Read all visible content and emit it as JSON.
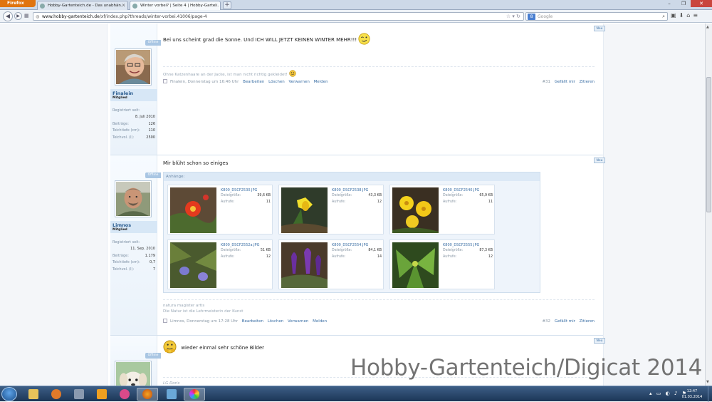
{
  "browser": {
    "menu_label": "Firefox",
    "tabs": [
      {
        "label": "Hobby-Gartenteich.de - Das unabhän..."
      },
      {
        "label": "Winter vorbei? | Seite 4 | Hobby-Garte..."
      }
    ],
    "new_tab": "+",
    "url_domain": "www.hobby-gartenteich.de",
    "url_path": "/xf/index.php?threads/winter-vorbei.41006/page-4",
    "search_placeholder": "Google",
    "search_engine": "8"
  },
  "posts": [
    {
      "status": "Offline",
      "username": "Finalein",
      "role": "Mitglied",
      "registered_label": "Registriert seit:",
      "registered_value": "8. Juli 2010",
      "stats": [
        {
          "label": "Beiträge:",
          "value": "126"
        },
        {
          "label": "Teichtiefe (cm):",
          "value": "110"
        },
        {
          "label": "Teichvol. (l):",
          "value": "2500"
        }
      ],
      "message": "Bei uns scheint grad die Sonne. Und ICH WILL JETZT KEINEN WINTER MEHR!!!",
      "signature": [
        "Ohne Katzenhaare an der Jacke, ist man nicht richtig gekleidet!"
      ],
      "meta": "Finalein, Donnerstag um 16:46 Uhr",
      "actions": [
        "Bearbeiten",
        "Löschen",
        "Verwarnen",
        "Melden"
      ],
      "number": "#31",
      "like": "Gefällt mir",
      "quote": "Zitieren",
      "new_badge": "Neu"
    },
    {
      "status": "Offline",
      "username": "Limnos",
      "role": "Mitglied",
      "registered_label": "Registriert seit:",
      "registered_value": "11. Sep. 2010",
      "stats": [
        {
          "label": "Beiträge:",
          "value": "1.179"
        },
        {
          "label": "Teichtiefe (cm):",
          "value": "0,7"
        },
        {
          "label": "Teichvol. (l):",
          "value": "7"
        }
      ],
      "message": "Mir blüht schon so einiges",
      "attachments_label": "Anhänge:",
      "attachments": [
        {
          "file": "K800_DSCF2530.JPG",
          "size_label": "Dateigröße:",
          "size": "39,6 KB",
          "views_label": "Aufrufe:",
          "views": "11"
        },
        {
          "file": "K800_DSCF2538.JPG",
          "size_label": "Dateigröße:",
          "size": "43,3 KB",
          "views_label": "Aufrufe:",
          "views": "12"
        },
        {
          "file": "K800_DSCF2540.JPG",
          "size_label": "Dateigröße:",
          "size": "65,9 KB",
          "views_label": "Aufrufe:",
          "views": "11"
        },
        {
          "file": "K800_DSCF2552a.JPG",
          "size_label": "Dateigröße:",
          "size": "51 KB",
          "views_label": "Aufrufe:",
          "views": "12"
        },
        {
          "file": "K800_DSCF2554.JPG",
          "size_label": "Dateigröße:",
          "size": "84,1 KB",
          "views_label": "Aufrufe:",
          "views": "14"
        },
        {
          "file": "K800_DSCF2555.JPG",
          "size_label": "Dateigröße:",
          "size": "87,3 KB",
          "views_label": "Aufrufe:",
          "views": "12"
        }
      ],
      "signature": [
        "natura magister artis",
        "Die Natur ist die Lehrmeisterin der Kunst"
      ],
      "meta": "Limnos, Donnerstag um 17:28 Uhr",
      "actions": [
        "Bearbeiten",
        "Löschen",
        "Verwarnen",
        "Melden"
      ],
      "number": "#32",
      "like": "Gefällt mir",
      "quote": "Zitieren",
      "new_badge": "Neu"
    },
    {
      "status": "Offline",
      "message": "wieder einmal sehr schöne Bilder",
      "signature": [
        "LG Doris"
      ],
      "new_badge": "Neu"
    }
  ],
  "watermark": "Hobby-Gartenteich/Digicat 2014",
  "taskbar": {
    "time": "12:47",
    "date": "01.03.2014"
  }
}
